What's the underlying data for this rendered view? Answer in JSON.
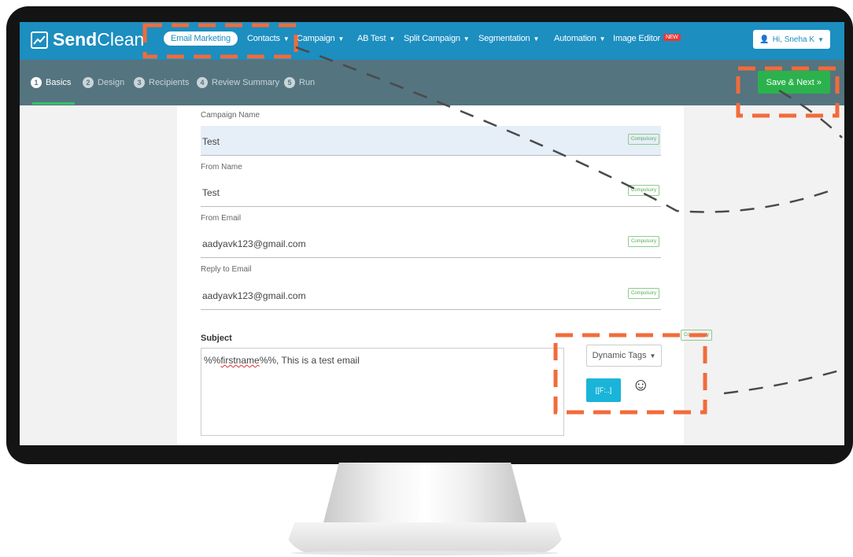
{
  "brand": {
    "logo_bold": "Send",
    "logo_light": "Clean"
  },
  "topnav": {
    "items": [
      {
        "label": "Email Marketing",
        "dropdown": false,
        "active": true
      },
      {
        "label": "Contacts",
        "dropdown": true
      },
      {
        "label": "Campaign",
        "dropdown": true
      },
      {
        "label": "AB Test",
        "dropdown": true
      },
      {
        "label": "Split Campaign",
        "dropdown": true
      },
      {
        "label": "Segmentation",
        "dropdown": true
      },
      {
        "label": "Automation",
        "dropdown": true
      },
      {
        "label": "Image Editor",
        "dropdown": false,
        "badge": "NEW"
      }
    ],
    "user_label": "Hi, Sneha K"
  },
  "steps": {
    "items": [
      {
        "num": "1",
        "label": "Basics",
        "active": true
      },
      {
        "num": "2",
        "label": "Design"
      },
      {
        "num": "3",
        "label": "Recipients"
      },
      {
        "num": "4",
        "label": "Review Summary"
      },
      {
        "num": "5",
        "label": "Run"
      }
    ],
    "save_next_label": "Save & Next »"
  },
  "form": {
    "fields": [
      {
        "label": "Campaign Name",
        "value": "Test",
        "tag": "Compulsory"
      },
      {
        "label": "From Name",
        "value": "Test",
        "tag": "Compulsory"
      },
      {
        "label": "From Email",
        "value": "aadyavk123@gmail.com",
        "tag": "Compulsory"
      },
      {
        "label": "Reply to Email",
        "value": "aadyavk123@gmail.com",
        "tag": "Compulsory"
      }
    ],
    "subject": {
      "label": "Subject",
      "tag": "Compulsory",
      "value_prefix": "%%",
      "value_token": "firstname",
      "value_suffix": "%%, This is a test email"
    },
    "dynamic_tags_label": "Dynamic Tags",
    "tag_button_label": "[[F:..]",
    "emoji_icon": "smiley-icon"
  },
  "colors": {
    "topnav": "#1c8ec0",
    "steps_bar": "#54747f",
    "save_button": "#2bb24c",
    "annotation": "#f26b3a"
  }
}
